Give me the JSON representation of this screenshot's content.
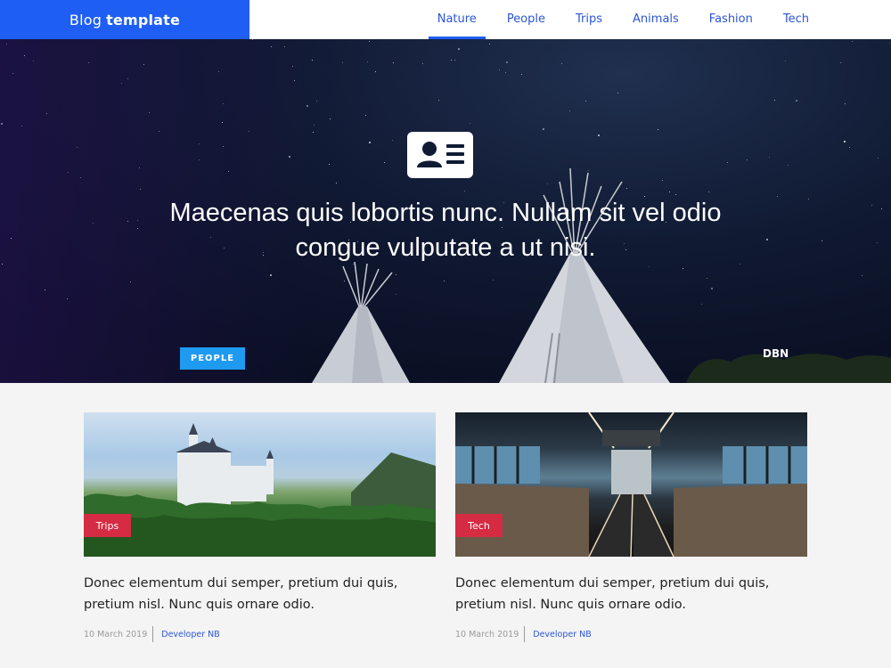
{
  "header": {
    "brand_prefix": "Blog",
    "brand_bold": "template",
    "nav": [
      {
        "label": "Nature",
        "active": true
      },
      {
        "label": "People"
      },
      {
        "label": "Trips"
      },
      {
        "label": "Animals"
      },
      {
        "label": "Fashion"
      },
      {
        "label": "Tech"
      }
    ]
  },
  "hero": {
    "icon": "contact-card-icon",
    "title": "Maecenas quis lobortis nunc. Nullam sit vel odio congue vulputate a ut nisi.",
    "tag": "PEOPLE",
    "credit": "DBN"
  },
  "cards": [
    {
      "tag": "Trips",
      "title": "Donec elementum dui semper, pretium dui quis, pretium nisl. Nunc quis ornare odio.",
      "date": "10 March 2019",
      "author": "Developer NB"
    },
    {
      "tag": "Tech",
      "title": "Donec elementum dui semper, pretium dui quis, pretium nisl. Nunc quis ornare odio.",
      "date": "10 March 2019",
      "author": "Developer NB"
    }
  ],
  "colors": {
    "brand": "#1e5ef2",
    "hero_tag": "#1e9af0",
    "card_tag": "#d52b43",
    "link": "#2b55d8"
  }
}
